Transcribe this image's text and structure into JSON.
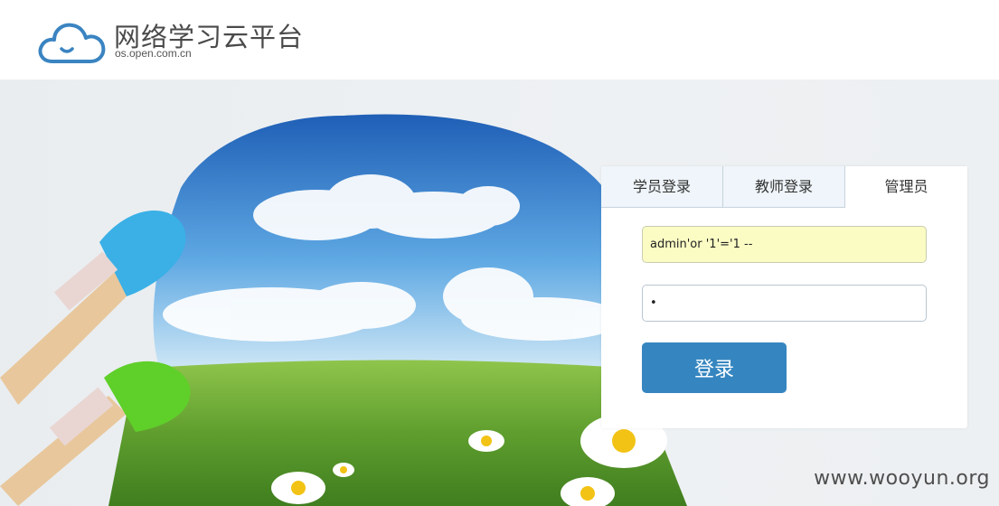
{
  "header": {
    "title": "网络学习云平台",
    "subtitle": "os.open.com.cn"
  },
  "login": {
    "tabs": [
      {
        "label": "学员登录"
      },
      {
        "label": "教师登录"
      },
      {
        "label": "管理员"
      }
    ],
    "active_tab": "管理员",
    "username_value": "admin'or '1'='1 --",
    "password_value": "•",
    "submit_label": "登录"
  },
  "watermark": "www.wooyun.org",
  "colors": {
    "brand_blue": "#3586c0",
    "username_fill": "#fbfcc4",
    "tab_inactive": "#eff5fa"
  }
}
